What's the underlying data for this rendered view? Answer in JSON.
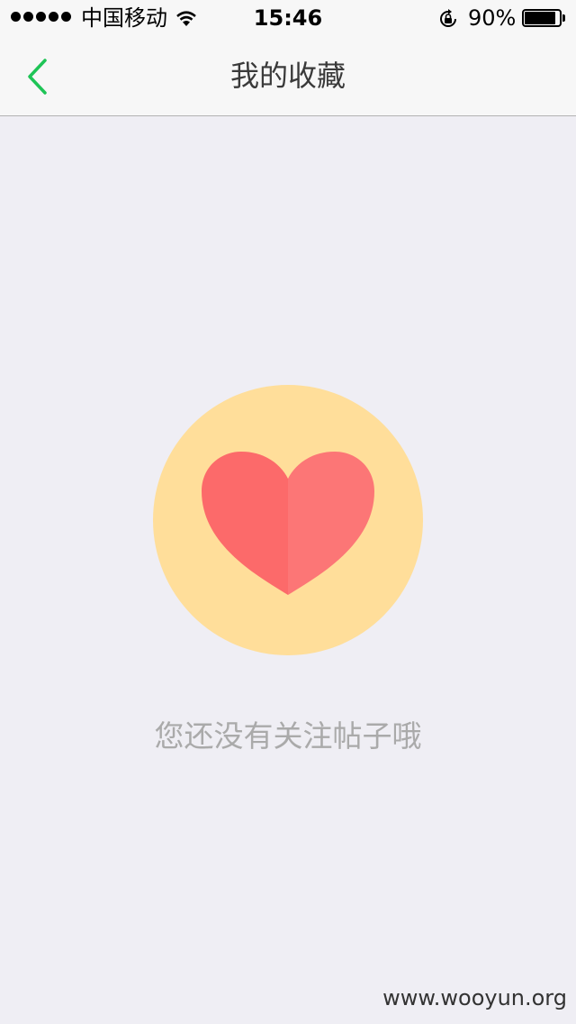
{
  "status_bar": {
    "carrier": "中国移动",
    "time": "15:46",
    "battery_percent": "90%",
    "battery_level": 0.9,
    "signal_bars": 5,
    "icons": [
      "signal-dots-icon",
      "wifi-icon",
      "rotation-lock-icon",
      "battery-icon"
    ]
  },
  "nav": {
    "title": "我的收藏",
    "back_icon": "chevron-left-icon"
  },
  "empty_state": {
    "illustration_icon": "heart-icon",
    "message": "您还没有关注帖子哦"
  },
  "watermark": "www.wooyun.org",
  "colors": {
    "accent": "#1ec456",
    "background": "#efeef4",
    "bar_background": "#f7f7f7",
    "circle": "#ffde9a",
    "heart_left": "#fc6a6a",
    "heart_right": "#fc7676",
    "message_text": "#aaaaaa"
  }
}
